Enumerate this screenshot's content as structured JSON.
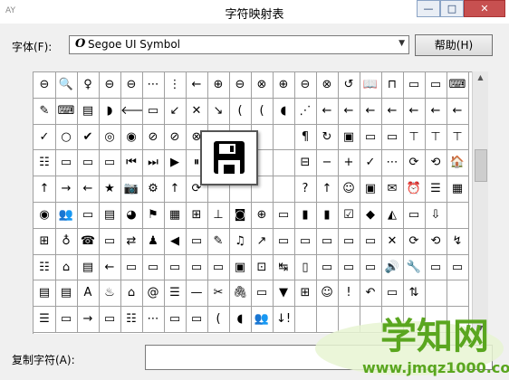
{
  "window": {
    "title": "字符映射表",
    "icon_text": "AY",
    "btn_min": "—",
    "btn_max": "□",
    "btn_close": "✕"
  },
  "font_row": {
    "label": "字体(F):",
    "glyph": "O",
    "value": "Segoe UI Symbol",
    "help_label": "帮助(H)"
  },
  "grid": {
    "rows": [
      [
        "⊖",
        "🔍",
        "♀",
        "⊖",
        "⊖",
        "⋯",
        "⋮",
        "←",
        "⊕",
        "⊖",
        "⊗",
        "⊕",
        "⊖",
        "⊗",
        "↺",
        "📖",
        "⊓",
        "▭",
        "▭",
        "⌨"
      ],
      [
        "✎",
        "⌨",
        "▤",
        "◗",
        "🡐",
        "▭",
        "↙",
        "✕",
        "↘",
        "(",
        "(",
        "◖",
        "⋰",
        "←",
        "←",
        "←",
        "←",
        "←",
        "←",
        "←"
      ],
      [
        "✓",
        "○",
        "✔",
        "◎",
        "◉",
        "⊘",
        "⊘",
        "⊗",
        "",
        "",
        "",
        "",
        "¶",
        "↻",
        "▣",
        "▭",
        "▭",
        "⊤",
        "⊤",
        "⊤"
      ],
      [
        "☷",
        "▭",
        "▭",
        "▭",
        "⏮",
        "⏭",
        "▶",
        "⏸",
        "",
        "",
        "",
        "",
        "⊟",
        "−",
        "+",
        "✓",
        "⋯",
        "⟳",
        "⟲",
        "🏠"
      ],
      [
        "↑",
        "→",
        "←",
        "★",
        "📷",
        "⚙",
        "↑",
        "⟳",
        "",
        "",
        "",
        "",
        "?",
        "↑",
        "☺",
        "▣",
        "✉",
        "⏰",
        "☰",
        "▦"
      ],
      [
        "◉",
        "👥",
        "▭",
        "▤",
        "◕",
        "⚑",
        "▦",
        "⊞",
        "⊥",
        "◙",
        "⊕",
        "▭",
        "▮",
        "▮",
        "☑",
        "◆",
        "◭",
        "▭",
        "⇩",
        ""
      ],
      [
        "⊞",
        "♁",
        "☎",
        "▭",
        "⇄",
        "♟",
        "◀",
        "▭",
        "✎",
        "♫",
        "↗",
        "▭",
        "▭",
        "▭",
        "▭",
        "▭",
        "✕",
        "⟳",
        "⟲",
        "↯"
      ],
      [
        "☷",
        "⌂",
        "▤",
        "←",
        "▭",
        "▭",
        "▭",
        "▭",
        "▭",
        "▣",
        "⊡",
        "↹",
        "▯",
        "▭",
        "▭",
        "▭",
        "🔊",
        "🔧",
        "▭",
        "▭"
      ],
      [
        "▤",
        "▤",
        "A",
        "♨",
        "⌂",
        "@",
        "☰",
        "—",
        "✂",
        "🖇",
        "▭",
        "▼",
        "⊞",
        "☺",
        "!",
        "↶",
        "▭",
        "⇅",
        "",
        ""
      ],
      [
        "☰",
        "▭",
        "→",
        "▭",
        "☷",
        "⋯",
        "▭",
        "▭",
        "(",
        "◖",
        "👥",
        "↓!",
        "",
        "",
        "",
        "",
        "",
        "",
        "",
        ""
      ]
    ]
  },
  "zoom_symbol": "floppy-disk",
  "copy_row": {
    "label": "复制字符(A):",
    "value": ""
  },
  "watermark": {
    "title": "学知网",
    "url": "www.jmqz1000.com"
  }
}
